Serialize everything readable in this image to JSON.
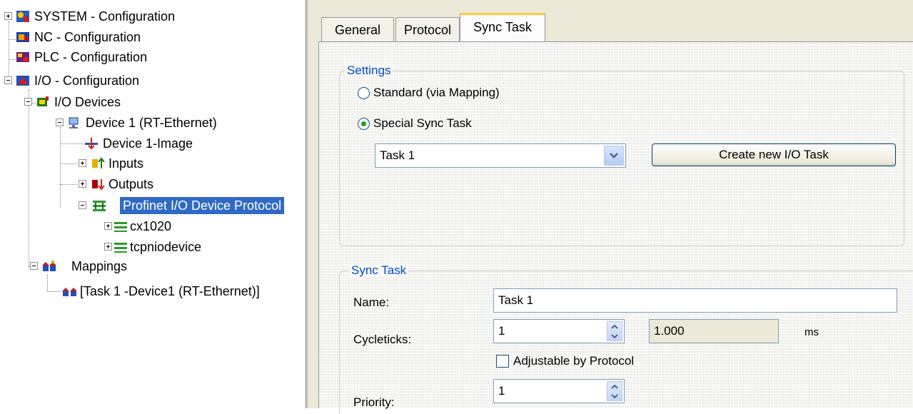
{
  "tree": {
    "items": [
      {
        "label": "SYSTEM - Configuration",
        "icon": "system-config-icon",
        "expander": "plus"
      },
      {
        "label": "NC - Configuration",
        "icon": "nc-config-icon",
        "expander": ""
      },
      {
        "label": "PLC - Configuration",
        "icon": "plc-config-icon",
        "expander": ""
      },
      {
        "label": "I/O - Configuration",
        "icon": "io-config-icon",
        "expander": "minus"
      },
      {
        "label": "I/O Devices",
        "icon": "io-devices-icon",
        "expander": "minus"
      },
      {
        "label": "Device 1 (RT-Ethernet)",
        "icon": "network-device-icon",
        "expander": "minus"
      },
      {
        "label": "Device 1-Image",
        "icon": "device-image-icon",
        "expander": ""
      },
      {
        "label": "Inputs",
        "icon": "inputs-icon",
        "expander": "plus"
      },
      {
        "label": "Outputs",
        "icon": "outputs-icon",
        "expander": "plus"
      },
      {
        "label": "Profinet I/O Device Protocol",
        "icon": "profinet-protocol-icon",
        "expander": "minus",
        "selected": true
      },
      {
        "label": "cx1020",
        "icon": "profinet-device-icon",
        "expander": "plus"
      },
      {
        "label": "tcpniodevice",
        "icon": "profinet-device-icon",
        "expander": "plus"
      },
      {
        "label": "Mappings",
        "icon": "mappings-icon",
        "expander": "minus"
      },
      {
        "label": "[Task 1 -Device1 (RT-Ethernet)]",
        "icon": "mapping-entry-icon",
        "expander": ""
      }
    ]
  },
  "tabs": [
    {
      "label": "General",
      "active": false
    },
    {
      "label": "Protocol",
      "active": false
    },
    {
      "label": "Sync Task",
      "active": true
    }
  ],
  "settings": {
    "title": "Settings",
    "radio_standard": "Standard (via Mapping)",
    "radio_special": "Special Sync Task",
    "selected": "special",
    "task_select_value": "Task 1",
    "create_button": "Create new I/O Task"
  },
  "sync_task": {
    "title": "Sync Task",
    "name_label": "Name:",
    "name_value": "Task 1",
    "cycleticks_label": "Cycleticks:",
    "cycleticks_value": "1",
    "cycle_time_value": "1.000",
    "cycle_time_unit": "ms",
    "adjustable_label": "Adjustable by Protocol",
    "adjustable_checked": false,
    "priority_label": "Priority:",
    "priority_value": "1"
  },
  "colors": {
    "selection": "#316ac5",
    "group_title": "#0046d5",
    "active_tab_accent": "#ffc83c",
    "window_face": "#ece9d8"
  }
}
